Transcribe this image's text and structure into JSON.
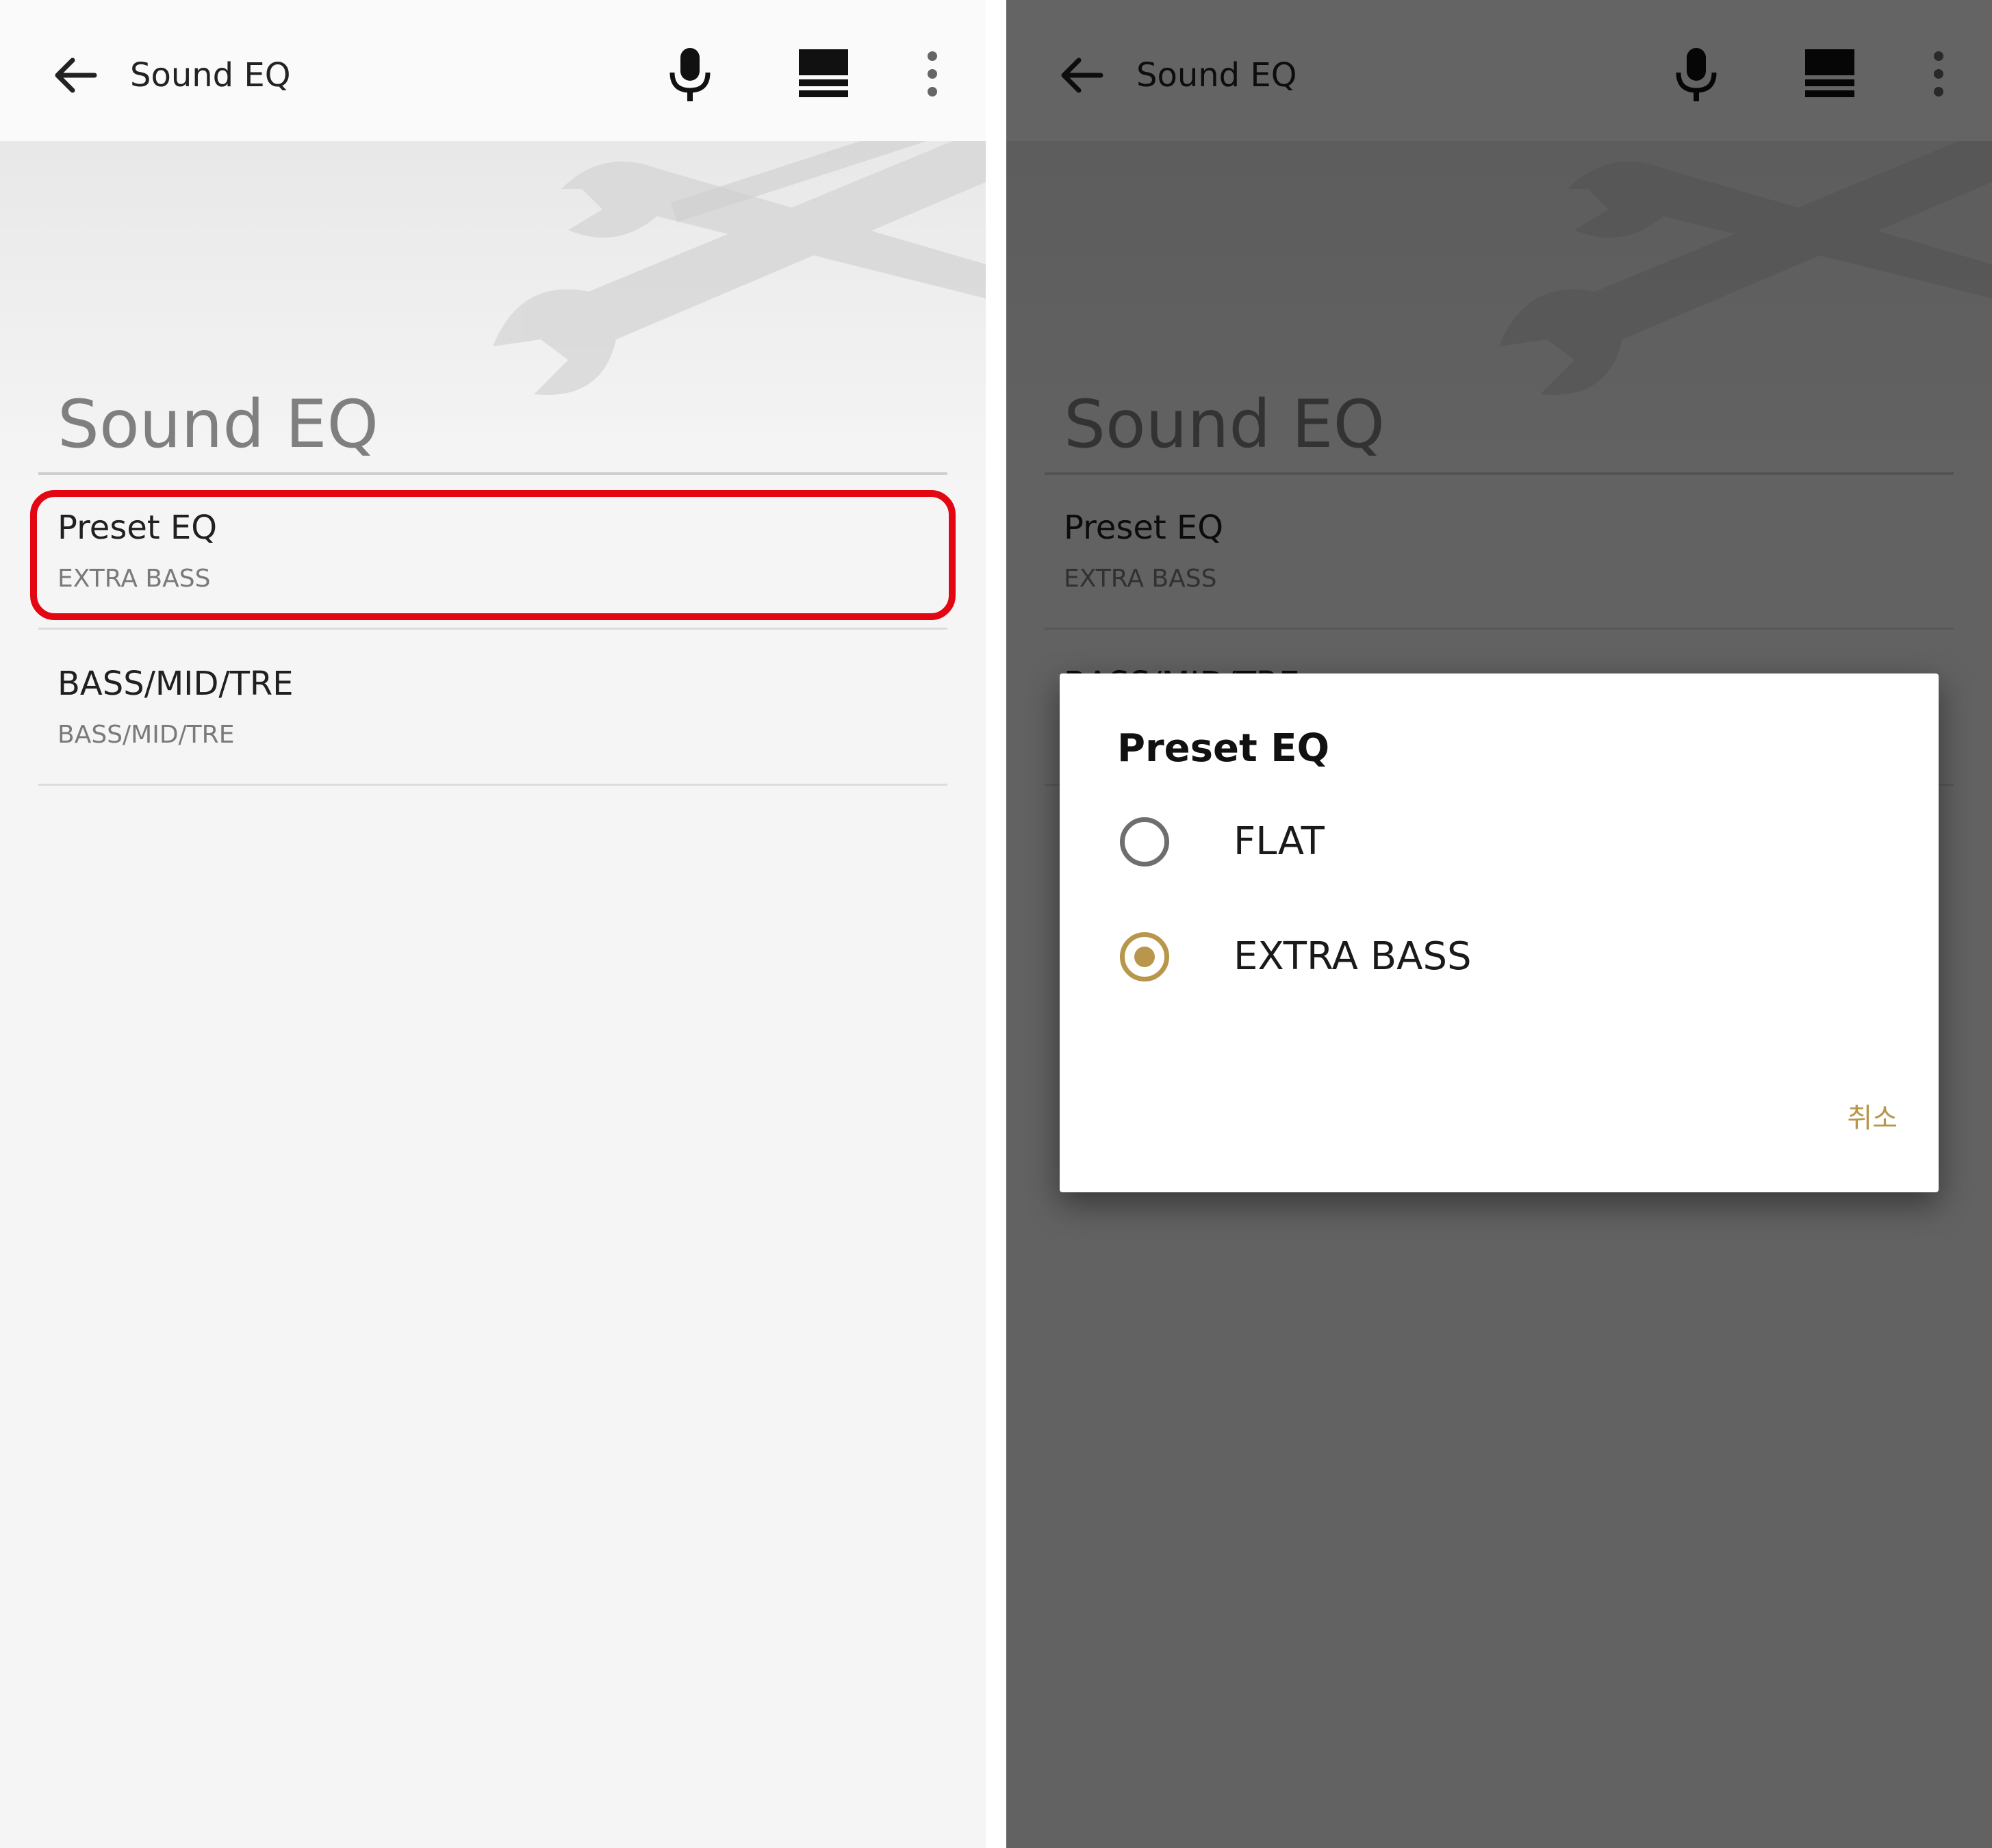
{
  "appbar": {
    "title": "Sound EQ",
    "icons": [
      "back-arrow-icon",
      "microphone-icon",
      "layout-icon",
      "more-vert-icon"
    ]
  },
  "section": {
    "title": "Sound EQ"
  },
  "preferences": [
    {
      "title": "Preset EQ",
      "summary": "EXTRA BASS"
    },
    {
      "title": "BASS/MID/TRE",
      "summary": "BASS/MID/TRE"
    }
  ],
  "dialog": {
    "title": "Preset EQ",
    "options": [
      {
        "label": "FLAT",
        "selected": false
      },
      {
        "label": "EXTRA BASS",
        "selected": true
      }
    ],
    "cancel_label": "취소"
  },
  "colors": {
    "accent": "#b8964b",
    "highlight": "#e30613",
    "overlay": "#000000"
  }
}
